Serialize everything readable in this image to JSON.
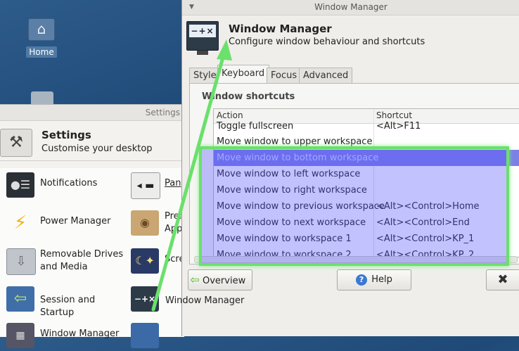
{
  "desktop": {
    "home_label": "Home"
  },
  "settings": {
    "window_title": "Settings",
    "title": "Settings",
    "subtitle": "Customise your desktop",
    "items": [
      {
        "label": "Notifications",
        "icon": "notifications-icon"
      },
      {
        "label": "Pan",
        "icon": "panel-icon"
      },
      {
        "label": "Power Manager",
        "icon": "power-manager-icon"
      },
      {
        "label": "Pref",
        "label2": "App",
        "icon": "preferred-apps-icon"
      },
      {
        "label": "Removable Drives",
        "label2": "and Media",
        "icon": "removable-drives-icon"
      },
      {
        "label": "Scre",
        "icon": "screensaver-icon"
      },
      {
        "label": "Session and Startup",
        "icon": "session-startup-icon"
      },
      {
        "label": "Window Manager",
        "icon": "window-manager-icon"
      },
      {
        "label": "Window Manager",
        "icon": "window-manager-tweaks-icon"
      }
    ]
  },
  "wm": {
    "window_title": "Window Manager",
    "title": "Window Manager",
    "subtitle": "Configure window behaviour and shortcuts",
    "icon_text": "−+×",
    "tabs": [
      {
        "label": "Style"
      },
      {
        "label": "Keyboard"
      },
      {
        "label": "Focus"
      },
      {
        "label": "Advanced"
      }
    ],
    "section_title": "Window shortcuts",
    "columns": {
      "action": "Action",
      "shortcut": "Shortcut"
    },
    "rows": [
      {
        "action": "Toggle fullscreen",
        "shortcut": "<Alt>F11"
      },
      {
        "action": "Move window to upper workspace",
        "shortcut": ""
      },
      {
        "action": "Move window to bottom workspace",
        "shortcut": ""
      },
      {
        "action": "Move window to left workspace",
        "shortcut": ""
      },
      {
        "action": "Move window to right workspace",
        "shortcut": ""
      },
      {
        "action": "Move window to previous workspace",
        "shortcut": "<Alt><Control>Home"
      },
      {
        "action": "Move window to next workspace",
        "shortcut": "<Alt><Control>End"
      },
      {
        "action": "Move window to workspace 1",
        "shortcut": "<Alt><Control>KP_1"
      },
      {
        "action": "Move window to workspace 2",
        "shortcut": "<Alt><Control>KP_2"
      }
    ],
    "buttons": {
      "overview": "Overview",
      "help": "Help"
    }
  },
  "colors": {
    "selection": "#7b7fe6",
    "annotation_green": "#6be06b"
  }
}
